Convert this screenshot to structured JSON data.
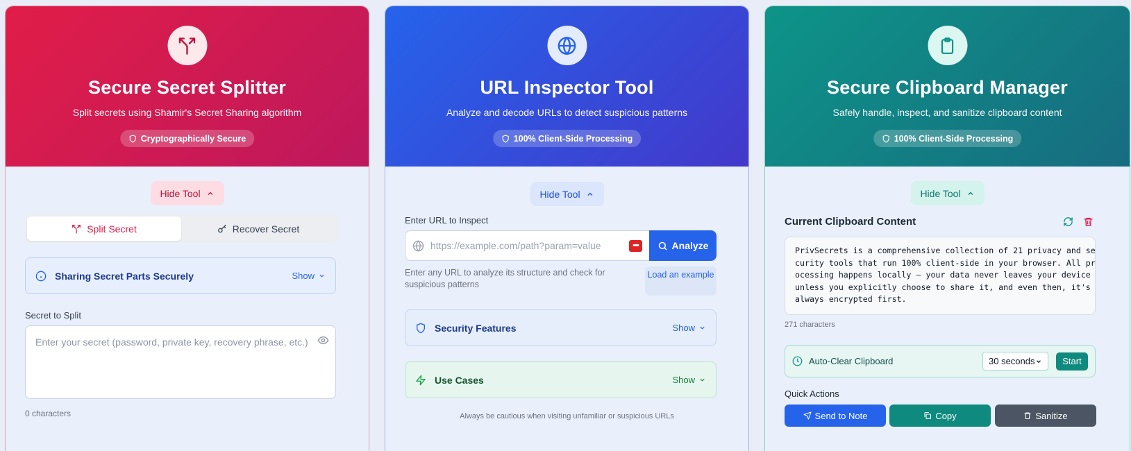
{
  "splitter": {
    "title": "Secure Secret Splitter",
    "subtitle": "Split secrets using Shamir's Secret Sharing algorithm",
    "badge": "Cryptographically Secure",
    "hide_tool": "Hide Tool",
    "tabs": [
      {
        "label": "Split Secret",
        "active": true
      },
      {
        "label": "Recover Secret",
        "active": false
      }
    ],
    "info_box": {
      "label": "Sharing Secret Parts Securely",
      "show": "Show"
    },
    "secret_label": "Secret to Split",
    "secret_placeholder": "Enter your secret (password, private key, recovery phrase, etc.)",
    "char_count": "0 characters"
  },
  "inspector": {
    "title": "URL Inspector Tool",
    "subtitle": "Analyze and decode URLs to detect suspicious patterns",
    "badge": "100% Client-Side Processing",
    "hide_tool": "Hide Tool",
    "url_label": "Enter URL to Inspect",
    "url_placeholder": "https://example.com/path?param=value",
    "analyze": "Analyze",
    "helper": "Enter any URL to analyze its structure and check for suspicious patterns",
    "load_example": "Load an example",
    "security_features": {
      "label": "Security Features",
      "show": "Show"
    },
    "use_cases": {
      "label": "Use Cases",
      "show": "Show"
    },
    "caution": "Always be cautious when visiting unfamiliar or suspicious URLs"
  },
  "clipboard": {
    "title": "Secure Clipboard Manager",
    "subtitle": "Safely handle, inspect, and sanitize clipboard content",
    "badge": "100% Client-Side Processing",
    "hide_tool": "Hide Tool",
    "content_title": "Current Clipboard Content",
    "content": "PrivSecrets is a comprehensive collection of 21 privacy and se\ncurity tools that run 100% client-side in your browser. All pr\nocessing happens locally — your data never leaves your device\nunless you explicitly choose to share it, and even then, it's\nalways encrypted first.",
    "char_count": "271 characters",
    "auto_clear": {
      "label": "Auto-Clear Clipboard",
      "selected": "30 seconds",
      "start": "Start"
    },
    "quick_actions": "Quick Actions",
    "actions": {
      "send": "Send to Note",
      "copy": "Copy",
      "sanitize": "Sanitize"
    }
  },
  "colors": {
    "splitter_accent": "#e11d48",
    "inspector_accent": "#2563eb",
    "clipboard_accent": "#0d9488"
  }
}
